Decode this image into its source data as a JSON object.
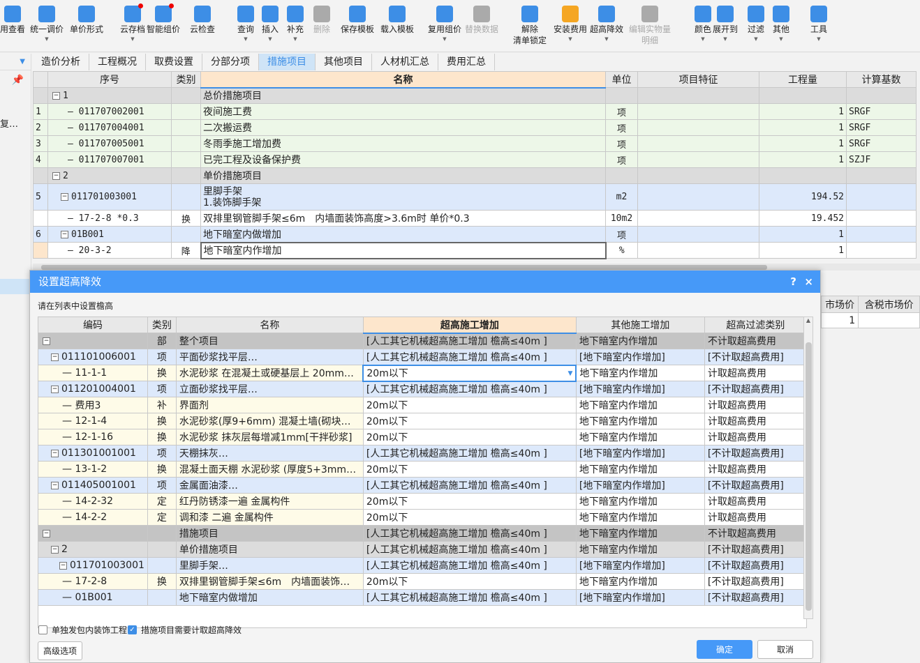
{
  "toolbar": {
    "items": [
      {
        "label": "用查看",
        "icon": "reuse-view-icon",
        "color": "#3d8ee6",
        "arrow": false,
        "disabled": false
      },
      {
        "label": "统一调价",
        "icon": "unify-price-icon",
        "color": "#3d8ee6",
        "arrow": true,
        "disabled": false
      },
      {
        "label": "单价形式",
        "icon": "unit-price-form-icon",
        "color": "#3d8ee6",
        "arrow": false,
        "disabled": false
      },
      {
        "label": "云存档",
        "icon": "cloud-save-icon",
        "color": "#3d8ee6",
        "arrow": true,
        "disabled": false,
        "dot": true
      },
      {
        "label": "智能组价",
        "icon": "smart-pricing-icon",
        "color": "#3d8ee6",
        "arrow": false,
        "disabled": false,
        "dot": true
      },
      {
        "label": "云检查",
        "icon": "cloud-check-icon",
        "color": "#3d8ee6",
        "arrow": false,
        "disabled": false
      },
      {
        "label": "查询",
        "icon": "query-icon",
        "color": "#3d8ee6",
        "arrow": true,
        "disabled": false
      },
      {
        "label": "插入",
        "icon": "insert-icon",
        "color": "#3d8ee6",
        "arrow": true,
        "disabled": false
      },
      {
        "label": "补充",
        "icon": "supplement-icon",
        "color": "#3d8ee6",
        "arrow": true,
        "disabled": false
      },
      {
        "label": "删除",
        "icon": "delete-icon",
        "color": "#aaa",
        "arrow": false,
        "disabled": true
      },
      {
        "label": "保存模板",
        "icon": "save-template-icon",
        "color": "#3d8ee6",
        "arrow": false,
        "disabled": false
      },
      {
        "label": "载入模板",
        "icon": "load-template-icon",
        "color": "#3d8ee6",
        "arrow": false,
        "disabled": false
      },
      {
        "label": "复用组价",
        "icon": "reuse-pricing-icon",
        "color": "#3d8ee6",
        "arrow": true,
        "disabled": false
      },
      {
        "label": "替换数据",
        "icon": "replace-data-icon",
        "color": "#aaa",
        "arrow": false,
        "disabled": true
      },
      {
        "label": "解除\n清单锁定",
        "icon": "unlock-icon",
        "color": "#3d8ee6",
        "arrow": false,
        "disabled": false
      },
      {
        "label": "安装费用",
        "icon": "install-fee-icon",
        "color": "#f5a623",
        "arrow": true,
        "disabled": false
      },
      {
        "label": "超高降效",
        "icon": "overheight-icon",
        "color": "#3d8ee6",
        "arrow": true,
        "disabled": false
      },
      {
        "label": "编辑实物量\n明细",
        "icon": "edit-quantity-icon",
        "color": "#aaa",
        "arrow": false,
        "disabled": true
      },
      {
        "label": "颜色",
        "icon": "color-icon",
        "color": "#3d8ee6",
        "arrow": true,
        "disabled": false
      },
      {
        "label": "展开到",
        "icon": "expand-to-icon",
        "color": "#3d8ee6",
        "arrow": true,
        "disabled": false
      },
      {
        "label": "过滤",
        "icon": "filter-icon",
        "color": "#3d8ee6",
        "arrow": true,
        "disabled": false
      },
      {
        "label": "其他",
        "icon": "other-icon",
        "color": "#3d8ee6",
        "arrow": true,
        "disabled": false
      },
      {
        "label": "工具",
        "icon": "tools-icon",
        "color": "#3d8ee6",
        "arrow": true,
        "disabled": false
      }
    ]
  },
  "tabs": [
    "造价分析",
    "工程概况",
    "取费设置",
    "分部分项",
    "措施项目",
    "其他项目",
    "人材机汇总",
    "费用汇总"
  ],
  "active_tab": "措施项目",
  "sidebar": {
    "text": "复…"
  },
  "grid": {
    "headers": [
      "",
      "序号",
      "类别",
      "名称",
      "单位",
      "项目特征",
      "工程量",
      "计算基数"
    ],
    "rows": [
      {
        "style": "gray",
        "no": "",
        "code": "1",
        "box": true,
        "type": "",
        "name": "总价措施项目",
        "unit": "",
        "feature": "",
        "qty": "",
        "base": ""
      },
      {
        "style": "green",
        "no": "1",
        "code": "011707002001",
        "box": false,
        "type": "",
        "name": "夜间施工费",
        "unit": "项",
        "feature": "",
        "qty": "1",
        "base": "SRGF"
      },
      {
        "style": "green",
        "no": "2",
        "code": "011707004001",
        "box": false,
        "type": "",
        "name": "二次搬运费",
        "unit": "项",
        "feature": "",
        "qty": "1",
        "base": "SRGF"
      },
      {
        "style": "green",
        "no": "3",
        "code": "011707005001",
        "box": false,
        "type": "",
        "name": "冬雨季施工增加费",
        "unit": "项",
        "feature": "",
        "qty": "1",
        "base": "SRGF"
      },
      {
        "style": "green",
        "no": "4",
        "code": "011707007001",
        "box": false,
        "type": "",
        "name": "已完工程及设备保护费",
        "unit": "项",
        "feature": "",
        "qty": "1",
        "base": "SZJF"
      },
      {
        "style": "gray",
        "no": "",
        "code": "2",
        "box": true,
        "type": "",
        "name": "单价措施项目",
        "unit": "",
        "feature": "",
        "qty": "",
        "base": ""
      },
      {
        "style": "blue",
        "no": "5",
        "code": "011701003001",
        "box": true,
        "type": "",
        "name": "里脚手架\n1.装饰脚手架",
        "unit": "m2",
        "feature": "",
        "qty": "194.52",
        "base": ""
      },
      {
        "style": "white",
        "no": "",
        "code": "17-2-8 *0.3",
        "box": false,
        "type": "换",
        "name": "双排里钢管脚手架≤6m　内墙面装饰高度>3.6m时 单价*0.3",
        "unit": "10m2",
        "feature": "",
        "qty": "19.452",
        "base": ""
      },
      {
        "style": "blue",
        "no": "6",
        "code": "01B001",
        "box": true,
        "type": "",
        "name": "地下暗室内做增加",
        "unit": "项",
        "feature": "",
        "qty": "1",
        "base": ""
      },
      {
        "style": "white",
        "no": "",
        "code": "20-3-2",
        "box": false,
        "type": "降",
        "name": "地下暗室内作增加",
        "unit": "%",
        "feature": "",
        "qty": "1",
        "base": ""
      }
    ]
  },
  "right_panel": {
    "headers": [
      "市场价",
      "含税市场价"
    ],
    "values": [
      "1",
      ""
    ]
  },
  "dialog": {
    "title": "设置超高降效",
    "help": "?",
    "close": "×",
    "hint": "请在列表中设置檐高",
    "headers": [
      "编码",
      "类别",
      "名称",
      "超高施工增加",
      "其他施工增加",
      "超高过滤类别"
    ],
    "rows": [
      {
        "style": "dark",
        "code": "",
        "box": true,
        "type": "部",
        "name": "整个项目",
        "over": "[人工其它机械超高施工增加 檐高≤40m ]",
        "other": "地下暗室内作增加",
        "filter": "不计取超高费用"
      },
      {
        "style": "blue",
        "code": "011101006001",
        "box": true,
        "type": "项",
        "name": "平面砂浆找平层…",
        "over": "[人工其它机械超高施工增加 檐高≤40m ]",
        "other": "[地下暗室内作增加]",
        "filter": "[不计取超高费用]"
      },
      {
        "style": "y",
        "code": "11-1-1",
        "box": false,
        "type": "换",
        "name": "水泥砂浆 在混凝土或硬基层上 20mm…",
        "over": "20m以下",
        "other": "地下暗室内作增加",
        "filter": "计取超高费用",
        "editing": true
      },
      {
        "style": "blue",
        "code": "011201004001",
        "box": true,
        "type": "项",
        "name": "立面砂浆找平层…",
        "over": "[人工其它机械超高施工增加 檐高≤40m ]",
        "other": "[地下暗室内作增加]",
        "filter": "[不计取超高费用]"
      },
      {
        "style": "y",
        "code": "费用3",
        "box": false,
        "type": "补",
        "name": "界面剂",
        "over": "20m以下",
        "other": "地下暗室内作增加",
        "filter": "计取超高费用"
      },
      {
        "style": "y",
        "code": "12-1-4",
        "box": false,
        "type": "换",
        "name": "水泥砂浆(厚9+6mm) 混凝土墙(砌块…",
        "over": "20m以下",
        "other": "地下暗室内作增加",
        "filter": "计取超高费用"
      },
      {
        "style": "y",
        "code": "12-1-16",
        "box": false,
        "type": "换",
        "name": "水泥砂浆 抹灰层每增减1mm[干拌砂浆]",
        "over": "20m以下",
        "other": "地下暗室内作增加",
        "filter": "计取超高费用"
      },
      {
        "style": "blue",
        "code": "011301001001",
        "box": true,
        "type": "项",
        "name": "天棚抹灰…",
        "over": "[人工其它机械超高施工增加 檐高≤40m ]",
        "other": "[地下暗室内作增加]",
        "filter": "[不计取超高费用]"
      },
      {
        "style": "y",
        "code": "13-1-2",
        "box": false,
        "type": "换",
        "name": "混凝土面天棚 水泥砂浆 (厚度5+3mm…",
        "over": "20m以下",
        "other": "地下暗室内作增加",
        "filter": "计取超高费用"
      },
      {
        "style": "blue",
        "code": "011405001001",
        "box": true,
        "type": "项",
        "name": "金属面油漆…",
        "over": "[人工其它机械超高施工增加 檐高≤40m ]",
        "other": "[地下暗室内作增加]",
        "filter": "[不计取超高费用]"
      },
      {
        "style": "y",
        "code": "14-2-32",
        "box": false,
        "type": "定",
        "name": "红丹防锈漆一遍 金属构件",
        "over": "20m以下",
        "other": "地下暗室内作增加",
        "filter": "计取超高费用"
      },
      {
        "style": "y",
        "code": "14-2-2",
        "box": false,
        "type": "定",
        "name": "调和漆 二遍 金属构件",
        "over": "20m以下",
        "other": "地下暗室内作增加",
        "filter": "计取超高费用"
      },
      {
        "style": "dark",
        "code": "",
        "box": true,
        "type": "",
        "name": "措施项目",
        "over": "[人工其它机械超高施工增加 檐高≤40m ]",
        "other": "地下暗室内作增加",
        "filter": "不计取超高费用"
      },
      {
        "style": "gray",
        "code": "2",
        "box": true,
        "type": "",
        "name": "单价措施项目",
        "over": "[人工其它机械超高施工增加 檐高≤40m ]",
        "other": "地下暗室内作增加",
        "filter": "[不计取超高费用]"
      },
      {
        "style": "blue",
        "code": "011701003001",
        "box": true,
        "type": "",
        "name": "里脚手架…",
        "over": "[人工其它机械超高施工增加 檐高≤40m ]",
        "other": "[地下暗室内作增加]",
        "filter": "[不计取超高费用]"
      },
      {
        "style": "y",
        "code": "17-2-8",
        "box": false,
        "type": "换",
        "name": "双排里钢管脚手架≤6m　内墙面装饰…",
        "over": "20m以下",
        "other": "地下暗室内作增加",
        "filter": "[不计取超高费用]"
      },
      {
        "style": "blue",
        "code": "01B001",
        "box": false,
        "type": "",
        "name": "地下暗室内做增加",
        "over": "[人工其它机械超高施工增加 檐高≤40m ]",
        "other": "[地下暗室内作增加]",
        "filter": "[不计取超高费用]"
      }
    ],
    "checkbox1": {
      "label": "单独发包内装饰工程",
      "checked": false
    },
    "checkbox2": {
      "label": "措施项目需要计取超高降效",
      "checked": true
    },
    "advanced_button": "高级选项",
    "ok_button": "确定",
    "cancel_button": "取消"
  }
}
